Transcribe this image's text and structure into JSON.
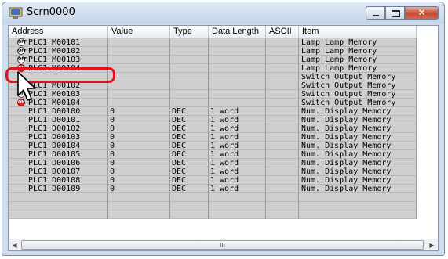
{
  "window": {
    "title": "Scrn0000",
    "close_label": "✕"
  },
  "columns": {
    "address": "Address",
    "value": "Value",
    "type": "Type",
    "data_length": "Data Length",
    "ascii": "ASCII",
    "item": "Item"
  },
  "rows": [
    {
      "icon": "off",
      "icon_text": "OFF",
      "address": "PLC1  M00101",
      "value": "",
      "type": "",
      "length": "",
      "ascii": "",
      "item": "Lamp Lamp Memory",
      "gray": true
    },
    {
      "icon": "off",
      "icon_text": "OFF",
      "address": "PLC1  M00102",
      "value": "",
      "type": "",
      "length": "",
      "ascii": "",
      "item": "Lamp Lamp Memory",
      "gray": true
    },
    {
      "icon": "off",
      "icon_text": "OFF",
      "address": "PLC1  M00103",
      "value": "",
      "type": "",
      "length": "",
      "ascii": "",
      "item": "Lamp Lamp Memory",
      "gray": true
    },
    {
      "icon": "on",
      "icon_text": "ON",
      "address": "PLC1  M00104",
      "value": "",
      "type": "",
      "length": "",
      "ascii": "",
      "item": "Lamp Lamp Memory",
      "gray": true
    },
    {
      "icon": "",
      "icon_text": "",
      "address": "",
      "value": "",
      "type": "",
      "length": "",
      "ascii": "",
      "item": "Switch Output Memory",
      "gray": true
    },
    {
      "icon": "off",
      "icon_text": "OFF",
      "address": "PLC1  M00102",
      "value": "",
      "type": "",
      "length": "",
      "ascii": "",
      "item": "Switch Output Memory",
      "gray": true
    },
    {
      "icon": "off",
      "icon_text": "OFF",
      "address": "PLC1  M00103",
      "value": "",
      "type": "",
      "length": "",
      "ascii": "",
      "item": "Switch Output Memory",
      "gray": true
    },
    {
      "icon": "on",
      "icon_text": "ON",
      "address": "PLC1  M00104",
      "value": "",
      "type": "",
      "length": "",
      "ascii": "",
      "item": "Switch Output Memory",
      "gray": true
    },
    {
      "icon": "",
      "icon_text": "",
      "address": "PLC1  D00100",
      "value": "0",
      "type": "DEC",
      "length": "1 word",
      "ascii": "",
      "item": "Num. Display Memory",
      "gray": true
    },
    {
      "icon": "",
      "icon_text": "",
      "address": "PLC1  D00101",
      "value": "0",
      "type": "DEC",
      "length": "1 word",
      "ascii": "",
      "item": "Num. Display Memory",
      "gray": true
    },
    {
      "icon": "",
      "icon_text": "",
      "address": "PLC1  D00102",
      "value": "0",
      "type": "DEC",
      "length": "1 word",
      "ascii": "",
      "item": "Num. Display Memory",
      "gray": true
    },
    {
      "icon": "",
      "icon_text": "",
      "address": "PLC1  D00103",
      "value": "0",
      "type": "DEC",
      "length": "1 word",
      "ascii": "",
      "item": "Num. Display Memory",
      "gray": true
    },
    {
      "icon": "",
      "icon_text": "",
      "address": "PLC1  D00104",
      "value": "0",
      "type": "DEC",
      "length": "1 word",
      "ascii": "",
      "item": "Num. Display Memory",
      "gray": true
    },
    {
      "icon": "",
      "icon_text": "",
      "address": "PLC1  D00105",
      "value": "0",
      "type": "DEC",
      "length": "1 word",
      "ascii": "",
      "item": "Num. Display Memory",
      "gray": true
    },
    {
      "icon": "",
      "icon_text": "",
      "address": "PLC1  D00106",
      "value": "0",
      "type": "DEC",
      "length": "1 word",
      "ascii": "",
      "item": "Num. Display Memory",
      "gray": true
    },
    {
      "icon": "",
      "icon_text": "",
      "address": "PLC1  D00107",
      "value": "0",
      "type": "DEC",
      "length": "1 word",
      "ascii": "",
      "item": "Num. Display Memory",
      "gray": true
    },
    {
      "icon": "",
      "icon_text": "",
      "address": "PLC1  D00108",
      "value": "0",
      "type": "DEC",
      "length": "1 word",
      "ascii": "",
      "item": "Num. Display Memory",
      "gray": true
    },
    {
      "icon": "",
      "icon_text": "",
      "address": "PLC1  D00109",
      "value": "0",
      "type": "DEC",
      "length": "1 word",
      "ascii": "",
      "item": "Num. Display Memory",
      "gray": true
    },
    {
      "icon": "",
      "icon_text": "",
      "address": "",
      "value": "",
      "type": "",
      "length": "",
      "ascii": "",
      "item": "",
      "gray": true
    },
    {
      "icon": "",
      "icon_text": "",
      "address": "",
      "value": "",
      "type": "",
      "length": "",
      "ascii": "",
      "item": "",
      "gray": true
    },
    {
      "icon": "",
      "icon_text": "",
      "address": "",
      "value": "",
      "type": "",
      "length": "",
      "ascii": "",
      "item": "",
      "gray": true
    }
  ],
  "scrollbar": {
    "left_arrow": "◀",
    "right_arrow": "▶",
    "grip": "III"
  },
  "colors": {
    "highlight": "#e8101a",
    "on_lamp": "#e02020"
  }
}
